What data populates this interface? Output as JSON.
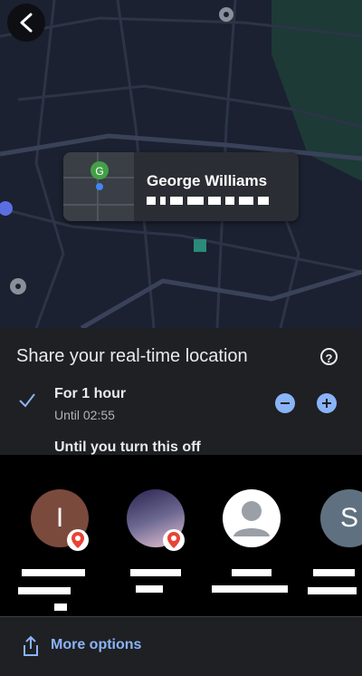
{
  "map": {
    "contact_name": "George Williams",
    "marker_letter": "G"
  },
  "share": {
    "title": "Share your real-time location",
    "help_icon": "question-circle-icon",
    "option_1": {
      "label": "For 1 hour",
      "sub": "Until 02:55",
      "selected": true
    },
    "option_2": {
      "label": "Until you turn this off"
    },
    "decrease_icon": "minus-icon",
    "increase_icon": "plus-icon"
  },
  "contacts": [
    {
      "initial": "I",
      "avatar_color": "#7a4a3d"
    },
    {
      "initial": "",
      "avatar_color": "#6a6790"
    },
    {
      "initial": "",
      "avatar_color": "#ffffff"
    },
    {
      "initial": "S",
      "avatar_color": "#5f7180"
    }
  ],
  "footer": {
    "more_label": "More options",
    "icon": "share-upload-icon"
  },
  "colors": {
    "accent": "#8ab4f8",
    "sheet": "#1f2024",
    "map_bg": "#1b2130"
  }
}
